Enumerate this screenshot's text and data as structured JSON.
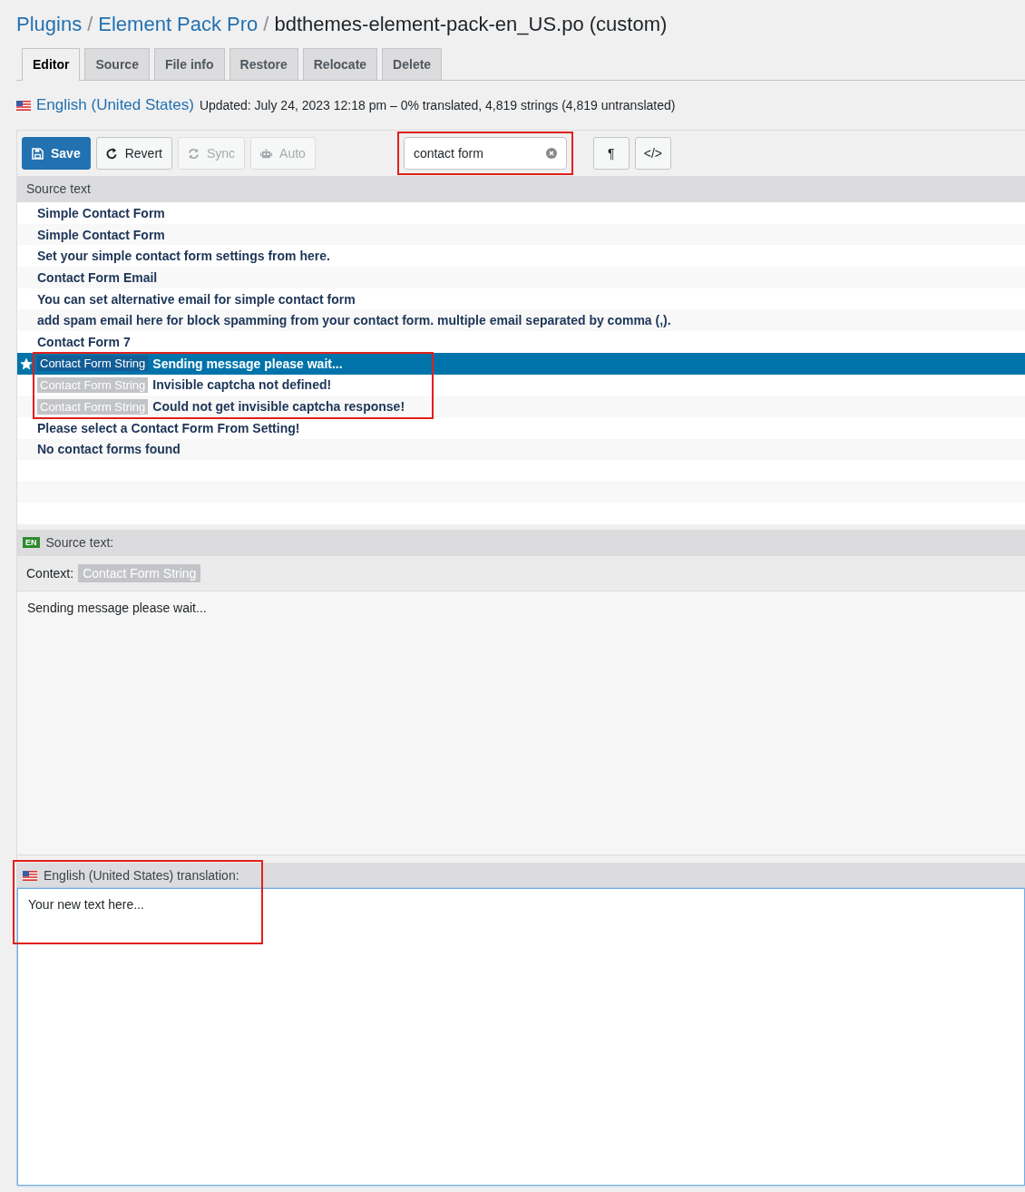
{
  "breadcrumb_separator": "/",
  "breadcrumb": [
    {
      "label": "Plugins",
      "link": true
    },
    {
      "label": "Element Pack Pro",
      "link": true
    },
    {
      "label": "bdthemes-element-pack-en_US.po (custom)",
      "link": false
    }
  ],
  "tabs": [
    {
      "label": "Editor",
      "selected": true
    },
    {
      "label": "Source",
      "selected": false
    },
    {
      "label": "File info",
      "selected": false
    },
    {
      "label": "Restore",
      "selected": false
    },
    {
      "label": "Relocate",
      "selected": false
    },
    {
      "label": "Delete",
      "selected": false
    }
  ],
  "locale": {
    "name": "English (United States)",
    "summary": "Updated: July 24, 2023 12:18 pm – 0% translated, 4,819 strings (4,819 untranslated)"
  },
  "toolbar": {
    "buttons": [
      {
        "label": "Save",
        "kind": "primary",
        "disabled": false
      },
      {
        "label": "Revert",
        "kind": "default",
        "disabled": false
      },
      {
        "label": "Sync",
        "kind": "default",
        "disabled": true
      },
      {
        "label": "Auto",
        "kind": "default",
        "disabled": true
      }
    ],
    "search": {
      "value": "contact form"
    },
    "toggles": [
      {
        "label": "¶"
      },
      {
        "label": "</>"
      }
    ]
  },
  "list": {
    "header": "Source text",
    "rows": [
      {
        "text": "Simple Contact Form",
        "selected": false
      },
      {
        "text": "Simple Contact Form",
        "selected": false
      },
      {
        "text": "Set your simple contact form settings from here.",
        "selected": false
      },
      {
        "text": "Contact Form Email",
        "selected": false
      },
      {
        "text": "You can set alternative email for simple contact form",
        "selected": false
      },
      {
        "text": "add spam email here for block spamming from your contact form. multiple email separated by comma (,).",
        "selected": false
      },
      {
        "text": "Contact Form 7",
        "selected": false
      },
      {
        "context": "Contact Form String",
        "text": "Sending message please wait...",
        "selected": true
      },
      {
        "context": "Contact Form String",
        "text": "Invisible captcha not defined!",
        "selected": false
      },
      {
        "context": "Contact Form String",
        "text": "Could not get invisible captcha response!",
        "selected": false
      },
      {
        "text": "Please select a Contact Form From Setting!",
        "selected": false
      },
      {
        "text": "No contact forms found",
        "selected": false
      }
    ]
  },
  "source": {
    "badge": "EN",
    "label": "Source text:",
    "context_label": "Context:",
    "context": "Contact Form String",
    "text": "Sending message please wait..."
  },
  "translation": {
    "label": "English (United States) translation:",
    "value": "Your new text here..."
  }
}
